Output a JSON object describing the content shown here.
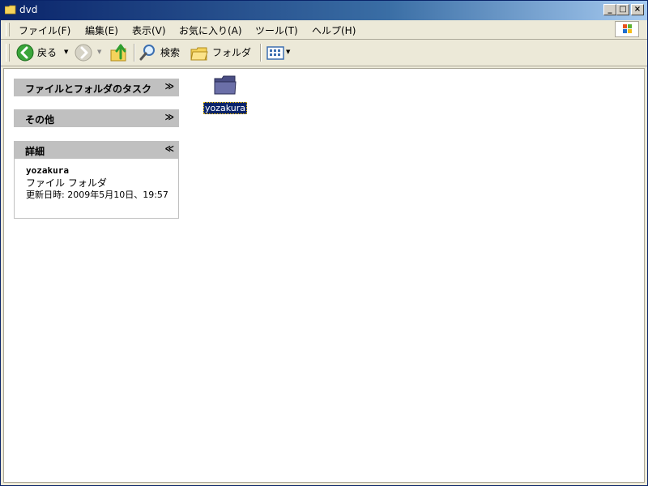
{
  "window": {
    "title": "dvd"
  },
  "caption_buttons": {
    "minimize": "_",
    "maximize": "□",
    "close": "×"
  },
  "menubar": {
    "items": [
      "ファイル(F)",
      "編集(E)",
      "表示(V)",
      "お気に入り(A)",
      "ツール(T)",
      "ヘルプ(H)"
    ]
  },
  "toolbar": {
    "back_label": "戻る",
    "search_label": "検索",
    "folders_label": "フォルダ"
  },
  "taskpane": {
    "file_tasks_title": "ファイルとフォルダのタスク",
    "other_title": "その他",
    "details_title": "詳細",
    "details": {
      "name": "yozakura",
      "type": "ファイル フォルダ",
      "modified": "更新日時: 2009年5月10日、19:57"
    }
  },
  "files": [
    {
      "name": "yozakura",
      "selected": true
    }
  ],
  "colors": {
    "title_gradient_start": "#0a246a",
    "selection": "#0a246a",
    "taskpane_header": "#c0c0c0"
  }
}
